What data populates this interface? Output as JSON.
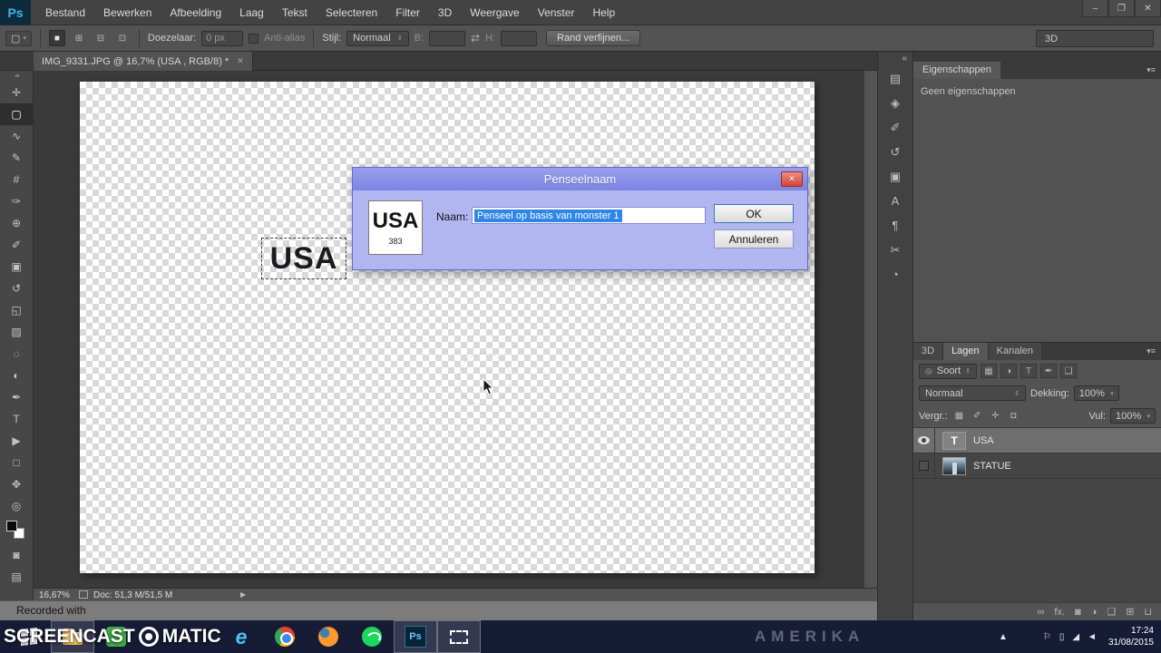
{
  "window": {
    "logo": "Ps",
    "minimize": "–",
    "restore": "❐",
    "close": "✕"
  },
  "ui": {
    "caret_down": "▾",
    "caret_updown": "⇕"
  },
  "menu": {
    "items": [
      "Bestand",
      "Bewerken",
      "Afbeelding",
      "Laag",
      "Tekst",
      "Selecteren",
      "Filter",
      "3D",
      "Weergave",
      "Venster",
      "Help"
    ]
  },
  "options": {
    "tool_glyph": "▢",
    "mode_icons": [
      {
        "name": "new-selection",
        "glyph": "■"
      },
      {
        "name": "add-to-selection",
        "glyph": "⊞"
      },
      {
        "name": "subtract-from-selection",
        "glyph": "⊟"
      },
      {
        "name": "intersect-selection",
        "glyph": "⊡"
      }
    ],
    "feather_label": "Doezelaar:",
    "feather_value": "0 px",
    "antialias_label": "Anti-alias",
    "style_label": "Stijl:",
    "style_value": "Normaal",
    "width_label": "B:",
    "width_value": "",
    "swap_glyph": "⇄",
    "height_label": "H:",
    "height_value": "",
    "refine_edge": "Rand verfijnen...",
    "workspace": "3D"
  },
  "doc_tab": {
    "title": "IMG_9331.JPG @ 16,7% (USA , RGB/8) *",
    "close": "✕"
  },
  "toolbox": {
    "collapse": "◂◂",
    "tools": [
      {
        "name": "move",
        "glyph": "✛"
      },
      {
        "name": "rectangular-marquee",
        "glyph": "▢"
      },
      {
        "name": "lasso",
        "glyph": "∿"
      },
      {
        "name": "quick-selection",
        "glyph": "✎"
      },
      {
        "name": "crop",
        "glyph": "#"
      },
      {
        "name": "eyedropper",
        "glyph": "✑"
      },
      {
        "name": "spot-healing",
        "glyph": "⊕"
      },
      {
        "name": "brush",
        "glyph": "✐"
      },
      {
        "name": "clone-stamp",
        "glyph": "▣"
      },
      {
        "name": "history-brush",
        "glyph": "↺"
      },
      {
        "name": "eraser",
        "glyph": "◱"
      },
      {
        "name": "gradient",
        "glyph": "▨"
      },
      {
        "name": "blur",
        "glyph": "◌"
      },
      {
        "name": "dodge",
        "glyph": "◐"
      },
      {
        "name": "pen",
        "glyph": "✒"
      },
      {
        "name": "type",
        "glyph": "T"
      },
      {
        "name": "path-selection",
        "glyph": "▶"
      },
      {
        "name": "shape",
        "glyph": "□"
      },
      {
        "name": "hand",
        "glyph": "✥"
      },
      {
        "name": "zoom",
        "glyph": "◎"
      }
    ],
    "extra": [
      {
        "name": "quick-mask-mode",
        "glyph": "◙"
      },
      {
        "name": "screen-mode",
        "glyph": "▤"
      }
    ]
  },
  "canvas": {
    "selection_label": "USA"
  },
  "dialog": {
    "title": "Penseelnaam",
    "close": "✕",
    "preview_text": "USA",
    "preview_number": "383",
    "name_label": "Naam:",
    "input_value": "Penseel op basis van monster 1",
    "ok": "OK",
    "cancel": "Annuleren"
  },
  "dock": {
    "collapse": "«",
    "icons": [
      {
        "name": "histogram",
        "glyph": "▤"
      },
      {
        "name": "navigator",
        "glyph": "◈"
      },
      {
        "name": "brush-presets",
        "glyph": "✐"
      },
      {
        "name": "history",
        "glyph": "↺"
      },
      {
        "name": "clone-source",
        "glyph": "▣"
      },
      {
        "name": "character",
        "glyph": "A"
      },
      {
        "name": "paragraph",
        "glyph": "¶"
      },
      {
        "name": "styles",
        "glyph": "✂"
      },
      {
        "name": "timeline",
        "glyph": "◔"
      }
    ]
  },
  "properties": {
    "tab": "Eigenschappen",
    "empty": "Geen eigenschappen",
    "menu_glyph": "▾≡"
  },
  "layers": {
    "tabs": [
      "3D",
      "Lagen",
      "Kanalen"
    ],
    "menu_glyph": "▾≡",
    "filter_search_glyph": "◎",
    "filter_label": "Soort",
    "filter_icons": [
      {
        "name": "filter-pixel-layers",
        "glyph": "▦"
      },
      {
        "name": "filter-adjustment-layers",
        "glyph": "◑"
      },
      {
        "name": "filter-type-layers",
        "glyph": "T"
      },
      {
        "name": "filter-shape-layers",
        "glyph": "✒"
      },
      {
        "name": "filter-smart-objects",
        "glyph": "❑"
      }
    ],
    "blend_mode": "Normaal",
    "opacity_label": "Dekking:",
    "opacity_value": "100%",
    "lock_label": "Vergr.:",
    "lock_icons": [
      {
        "name": "lock-transparency",
        "glyph": "▦"
      },
      {
        "name": "lock-pixels",
        "glyph": "✐"
      },
      {
        "name": "lock-position",
        "glyph": "✛"
      },
      {
        "name": "lock-all",
        "glyph": "◘"
      }
    ],
    "fill_label": "Vul:",
    "fill_value": "100%",
    "rows": [
      {
        "name": "USA",
        "thumb": "T"
      },
      {
        "name": "STATUE"
      }
    ],
    "bottom_icons": [
      {
        "name": "link-layers",
        "glyph": "∞"
      },
      {
        "name": "layer-effects",
        "glyph": "fx."
      },
      {
        "name": "layer-mask",
        "glyph": "◙"
      },
      {
        "name": "adjustment-layer",
        "glyph": "◑"
      },
      {
        "name": "layer-group",
        "glyph": "❑"
      },
      {
        "name": "new-layer",
        "glyph": "⊞"
      },
      {
        "name": "delete-layer",
        "glyph": "⊔"
      }
    ]
  },
  "status": {
    "zoom": "16,67%",
    "doc": "Doc: 51,3 M/51,5 M",
    "arrow": "▶"
  },
  "overlay": {
    "recorded": "Recorded with",
    "brand_left": "SCREENCAST",
    "brand_right": "MATIC"
  },
  "taskbar": {
    "wallpaper_text": "AMERIKA",
    "ie_letter": "e",
    "ps_label": "Ps",
    "tray_icons": [
      {
        "name": "tray-hidden-icons",
        "glyph": "▲"
      },
      {
        "name": "tray-action-center",
        "glyph": "⚐"
      },
      {
        "name": "tray-power",
        "glyph": "▯"
      },
      {
        "name": "tray-network",
        "glyph": "◢"
      },
      {
        "name": "tray-volume",
        "glyph": "◄"
      }
    ],
    "time": "17:24",
    "date": "31/08/2015"
  }
}
